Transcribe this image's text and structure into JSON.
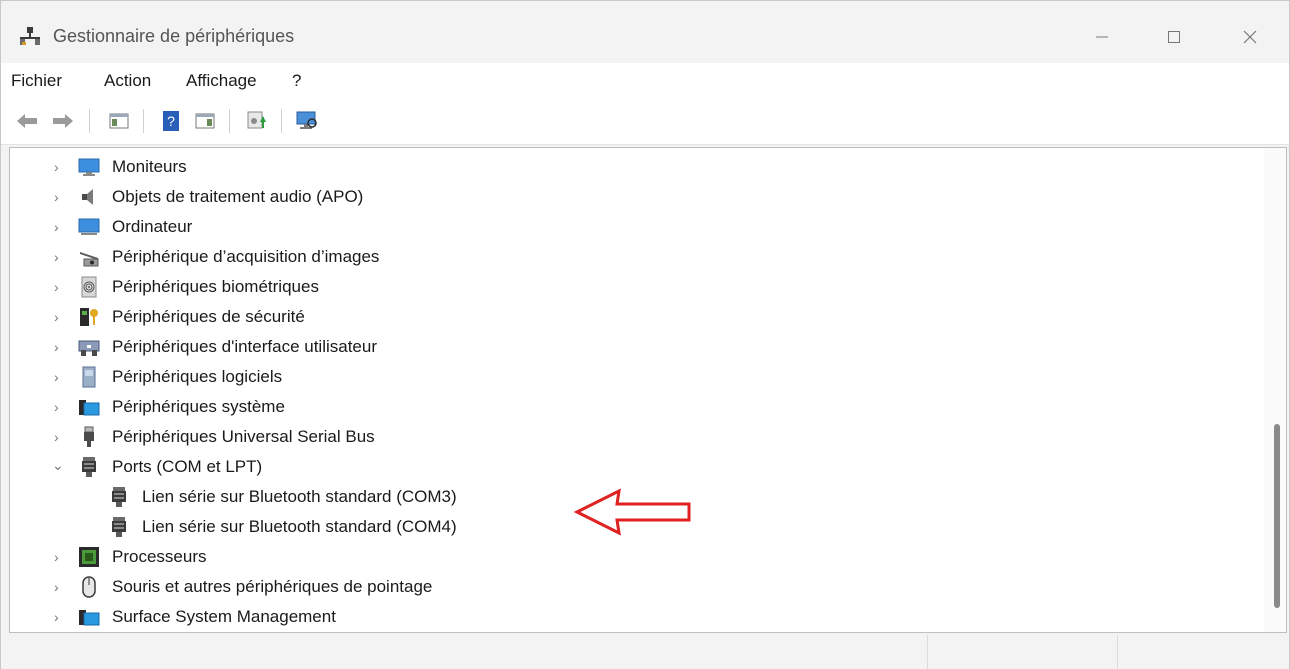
{
  "window": {
    "title": "Gestionnaire de périphériques",
    "controls": {
      "minimize": "—",
      "maximize": "☐",
      "close": "✕"
    }
  },
  "menu": [
    "Fichier",
    "Action",
    "Affichage",
    "?"
  ],
  "toolbar": {
    "icons": [
      "back-arrow-icon",
      "forward-arrow-icon",
      "show-hide-console-tree-icon",
      "help-icon",
      "properties-pane-icon",
      "update-driver-icon",
      "scan-hardware-icon"
    ]
  },
  "tree": {
    "items": [
      {
        "label": "Moniteurs",
        "icon": "monitor-icon",
        "expanded": false,
        "level": 0
      },
      {
        "label": "Objets de traitement audio (APO)",
        "icon": "speaker-icon",
        "expanded": false,
        "level": 0
      },
      {
        "label": "Ordinateur",
        "icon": "computer-icon",
        "expanded": false,
        "level": 0
      },
      {
        "label": "Périphérique d’acquisition d’images",
        "icon": "scanner-icon",
        "expanded": false,
        "level": 0
      },
      {
        "label": "Périphériques biométriques",
        "icon": "fingerprint-icon",
        "expanded": false,
        "level": 0
      },
      {
        "label": "Périphériques de sécurité",
        "icon": "security-key-icon",
        "expanded": false,
        "level": 0
      },
      {
        "label": "Périphériques d'interface utilisateur",
        "icon": "hid-icon",
        "expanded": false,
        "level": 0
      },
      {
        "label": "Périphériques logiciels",
        "icon": "software-device-icon",
        "expanded": false,
        "level": 0
      },
      {
        "label": "Périphériques système",
        "icon": "system-folder-icon",
        "expanded": false,
        "level": 0
      },
      {
        "label": "Périphériques Universal Serial Bus",
        "icon": "usb-plug-icon",
        "expanded": false,
        "level": 0
      },
      {
        "label": "Ports (COM et LPT)",
        "icon": "port-connector-icon",
        "expanded": true,
        "level": 0
      },
      {
        "label": "Lien série sur Bluetooth standard (COM3)",
        "icon": "port-connector-icon",
        "level": 1
      },
      {
        "label": "Lien série sur Bluetooth standard (COM4)",
        "icon": "port-connector-icon",
        "level": 1
      },
      {
        "label": "Processeurs",
        "icon": "processor-chip-icon",
        "expanded": false,
        "level": 0
      },
      {
        "label": "Souris et autres périphériques de pointage",
        "icon": "mouse-icon",
        "expanded": false,
        "level": 0
      },
      {
        "label": "Surface System Management",
        "icon": "system-folder-icon",
        "expanded": false,
        "level": 0
      }
    ]
  },
  "annotation": {
    "color": "#e02020",
    "icon": "red-arrow-icon"
  }
}
